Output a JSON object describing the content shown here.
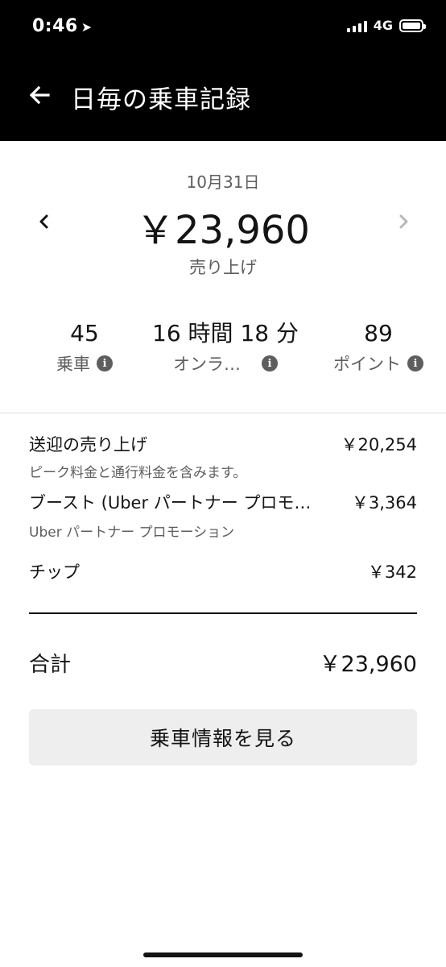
{
  "status": {
    "time": "0:46",
    "network": "4G"
  },
  "header": {
    "title": "日毎の乗車記録"
  },
  "summary": {
    "date": "10月31日",
    "amount": "￥23,960",
    "label": "売り上げ"
  },
  "stats": [
    {
      "value": "45",
      "label": "乗車"
    },
    {
      "value": "16 時間 18 分",
      "label": "オンラ…"
    },
    {
      "value": "89",
      "label": "ポイント"
    }
  ],
  "breakdown": {
    "fare": {
      "label": "送迎の売り上げ",
      "value": "￥20,254",
      "note": "ピーク料金と通行料金を含みます。"
    },
    "boost": {
      "label": "ブースト (Uber パートナー プロモ…",
      "value": "￥3,364",
      "note": "Uber パートナー プロモーション"
    },
    "tip": {
      "label": "チップ",
      "value": "￥342"
    }
  },
  "total": {
    "label": "合計",
    "value": "￥23,960"
  },
  "actions": {
    "view_trips": "乗車情報を見る"
  },
  "colors": {
    "header_bg": "#000000",
    "text_primary": "#141414",
    "text_secondary": "#5e5e5e",
    "button_bg": "#eeeeee"
  }
}
